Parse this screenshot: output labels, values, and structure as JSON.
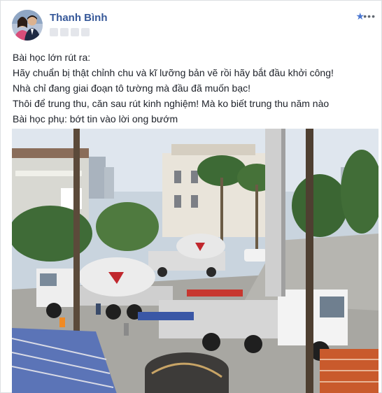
{
  "post": {
    "author_name": "Thanh Bình",
    "lines": [
      "Bài học lớn rút ra:",
      "Hãy chuẩn bị thật chỉnh chu và kĩ lưỡng bản vẽ rồi hãy bắt đầu khởi công!",
      "Nhà chỉ đang giai đoạn tô tường mà đầu đã muốn bạc!",
      "Thôi để trung thu, căn sau rút kinh nghiệm! Mà ko biết trung thu năm nào",
      "Bài học phụ: bớt tin vào lời ong bướm"
    ]
  },
  "icons": {
    "star": "star-icon",
    "more": "more-options-icon"
  },
  "colors": {
    "author_link": "#365899",
    "accent": "#4a76d1",
    "text": "#1d2129"
  }
}
